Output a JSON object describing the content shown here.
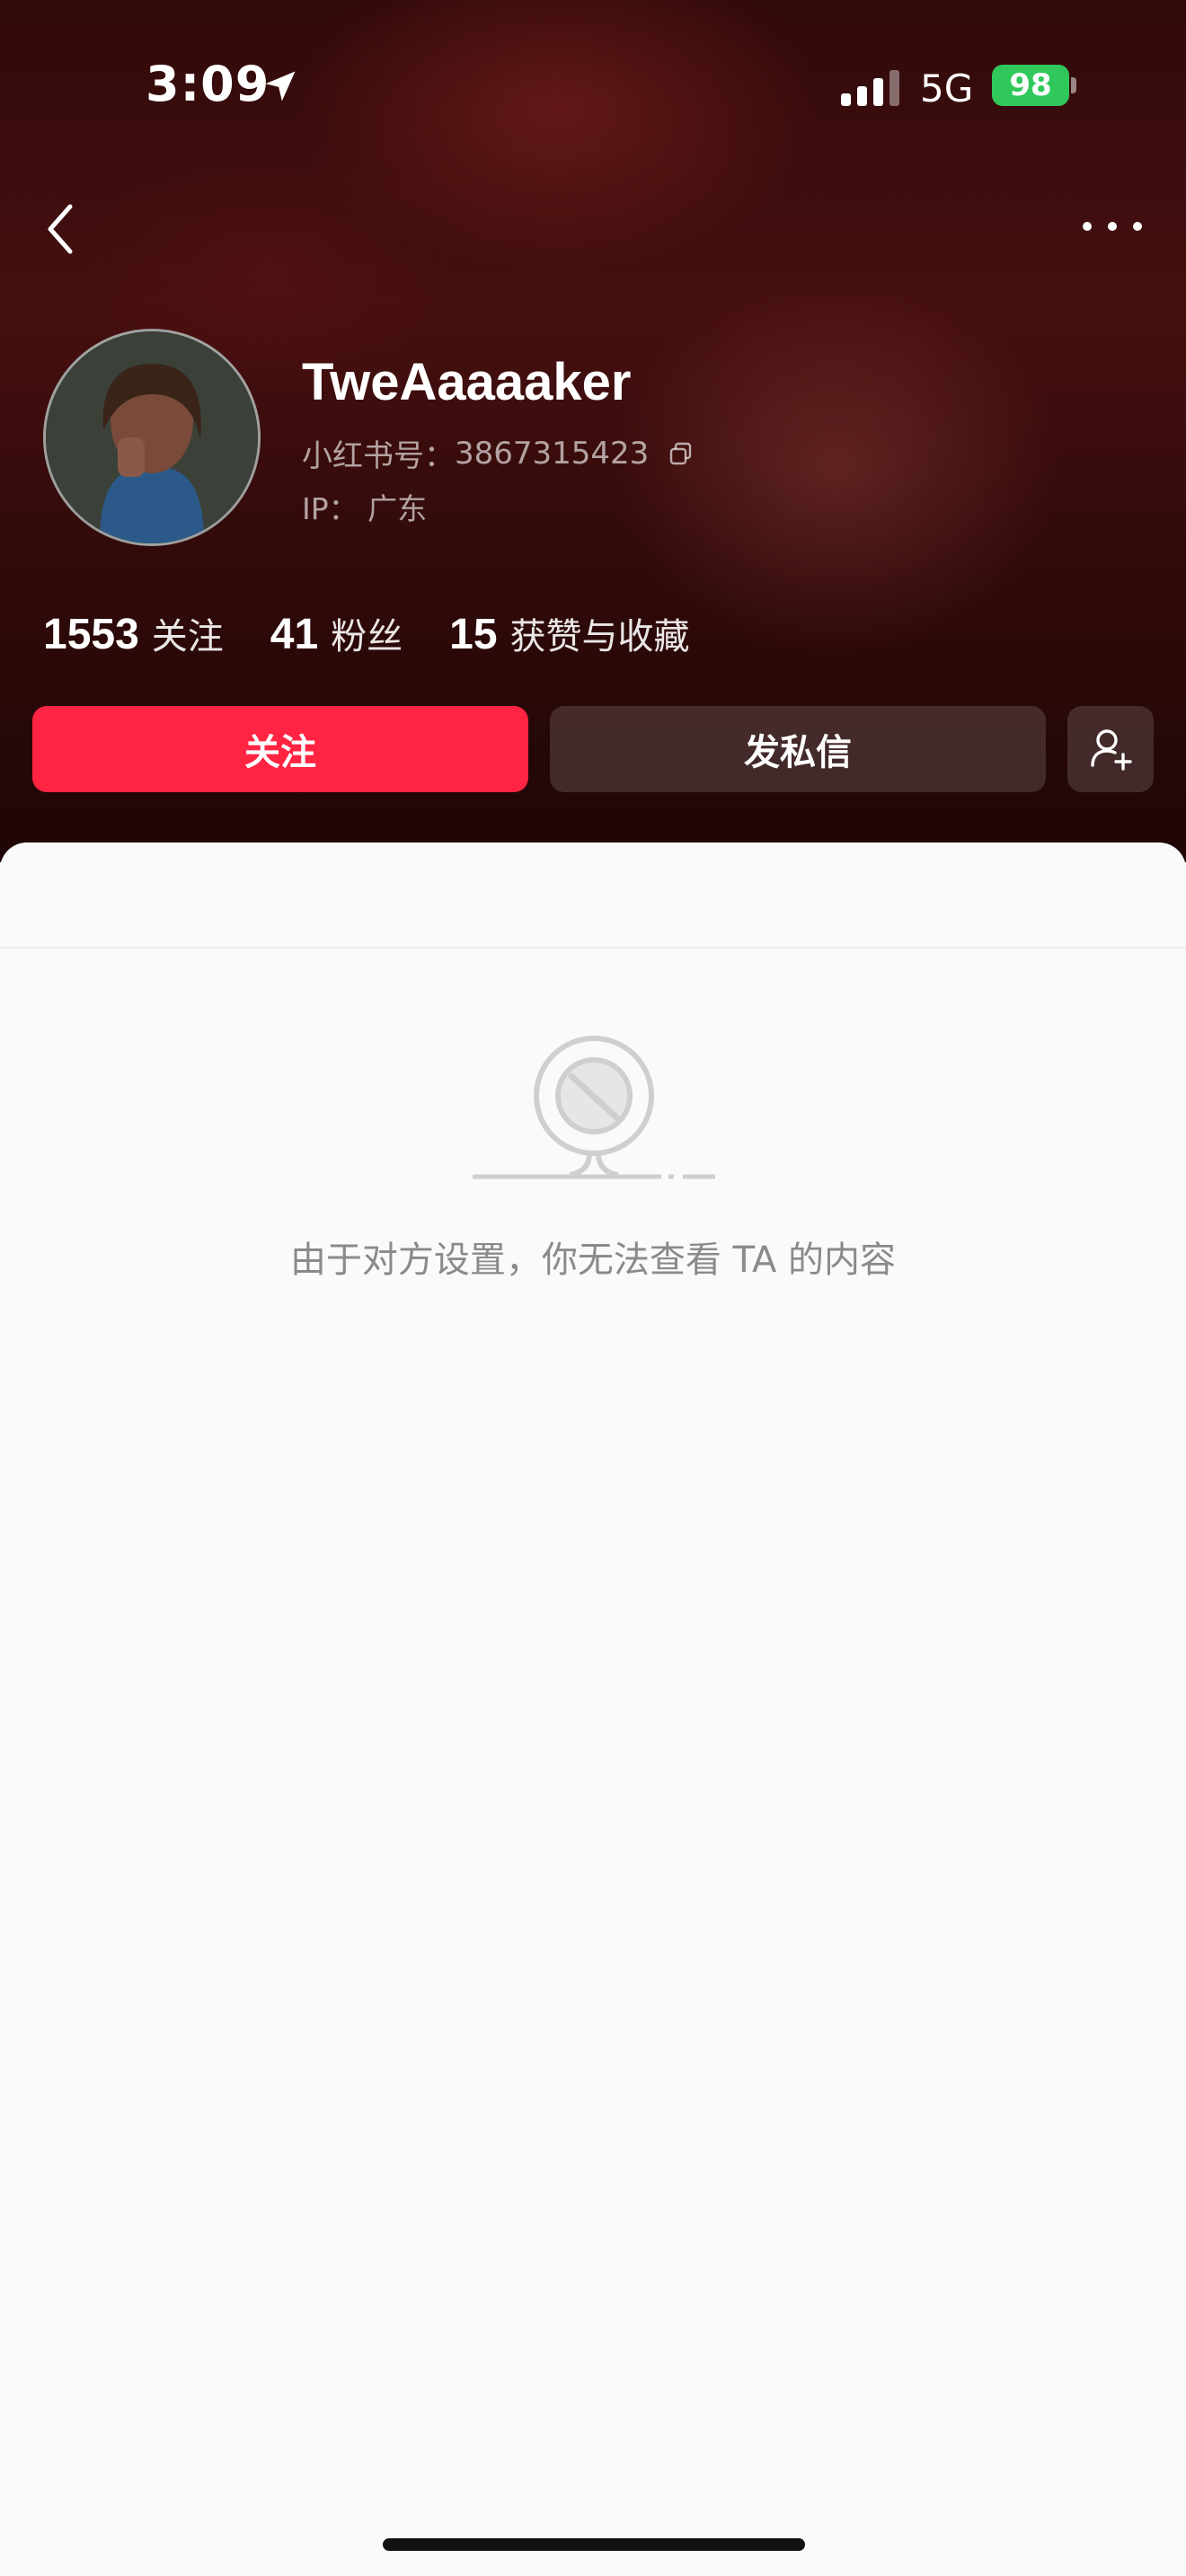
{
  "status_bar": {
    "time": "3:09",
    "network": "5G",
    "battery": "98"
  },
  "profile": {
    "username": "TweAaaaaker",
    "red_id_label": "小红书号：",
    "red_id": "3867315423",
    "ip_label": "IP：",
    "ip_location": "广东"
  },
  "stats": [
    {
      "value": "1553",
      "label": "关注"
    },
    {
      "value": "41",
      "label": "粉丝"
    },
    {
      "value": "15",
      "label": "获赞与收藏"
    }
  ],
  "actions": {
    "follow_label": "关注",
    "message_label": "发私信"
  },
  "content": {
    "empty_message": "由于对方设置，你无法查看 TA 的内容"
  },
  "colors": {
    "accent": "#ff2442",
    "battery": "#30c85a",
    "header_bg": "#3a0b0b"
  },
  "icons": [
    "location-arrow-icon",
    "signal-icon",
    "back-icon",
    "more-icon",
    "copy-icon",
    "add-friend-icon",
    "blocked-content-icon"
  ]
}
